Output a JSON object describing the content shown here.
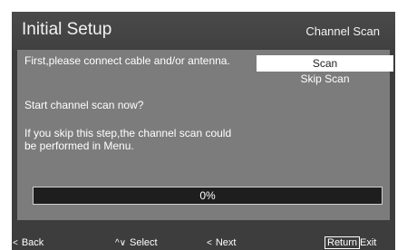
{
  "header": {
    "title": "Initial Setup",
    "section": "Channel Scan"
  },
  "messages": {
    "connect": "First,please connect cable and/or antenna.",
    "question": "Start channel scan now?",
    "skip_note": "If you skip this step,the channel scan could be performed in Menu."
  },
  "options": [
    {
      "label": "Scan",
      "selected": true
    },
    {
      "label": "Skip Scan",
      "selected": false
    }
  ],
  "progress": {
    "label": "0%",
    "value": 0
  },
  "footer": {
    "back": {
      "icon": "chevron-left-icon",
      "label": "Back"
    },
    "select": {
      "icon": "up-down-arrows-icon",
      "label": "Select"
    },
    "next": {
      "icon": "chevron-left-icon",
      "label": "Next"
    },
    "exit": {
      "key": "Return",
      "label": "Exit"
    }
  },
  "colors": {
    "background": "#3d3d3d",
    "panel": "#7c7c7c",
    "selected_option": "#ffffff",
    "progress_track": "#1e1e1e"
  }
}
